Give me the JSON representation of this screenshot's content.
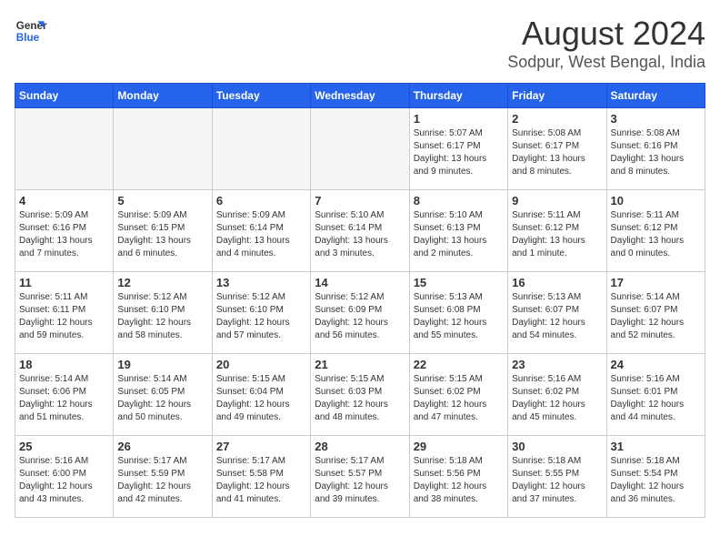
{
  "header": {
    "logo_line1": "General",
    "logo_line2": "Blue",
    "title": "August 2024",
    "subtitle": "Sodpur, West Bengal, India"
  },
  "columns": [
    "Sunday",
    "Monday",
    "Tuesday",
    "Wednesday",
    "Thursday",
    "Friday",
    "Saturday"
  ],
  "weeks": [
    [
      {
        "day": "",
        "empty": true
      },
      {
        "day": "",
        "empty": true
      },
      {
        "day": "",
        "empty": true
      },
      {
        "day": "",
        "empty": true
      },
      {
        "day": "1",
        "info": "Sunrise: 5:07 AM\nSunset: 6:17 PM\nDaylight: 13 hours\nand 9 minutes."
      },
      {
        "day": "2",
        "info": "Sunrise: 5:08 AM\nSunset: 6:17 PM\nDaylight: 13 hours\nand 8 minutes."
      },
      {
        "day": "3",
        "info": "Sunrise: 5:08 AM\nSunset: 6:16 PM\nDaylight: 13 hours\nand 8 minutes."
      }
    ],
    [
      {
        "day": "4",
        "info": "Sunrise: 5:09 AM\nSunset: 6:16 PM\nDaylight: 13 hours\nand 7 minutes."
      },
      {
        "day": "5",
        "info": "Sunrise: 5:09 AM\nSunset: 6:15 PM\nDaylight: 13 hours\nand 6 minutes."
      },
      {
        "day": "6",
        "info": "Sunrise: 5:09 AM\nSunset: 6:14 PM\nDaylight: 13 hours\nand 4 minutes."
      },
      {
        "day": "7",
        "info": "Sunrise: 5:10 AM\nSunset: 6:14 PM\nDaylight: 13 hours\nand 3 minutes."
      },
      {
        "day": "8",
        "info": "Sunrise: 5:10 AM\nSunset: 6:13 PM\nDaylight: 13 hours\nand 2 minutes."
      },
      {
        "day": "9",
        "info": "Sunrise: 5:11 AM\nSunset: 6:12 PM\nDaylight: 13 hours\nand 1 minute."
      },
      {
        "day": "10",
        "info": "Sunrise: 5:11 AM\nSunset: 6:12 PM\nDaylight: 13 hours\nand 0 minutes."
      }
    ],
    [
      {
        "day": "11",
        "info": "Sunrise: 5:11 AM\nSunset: 6:11 PM\nDaylight: 12 hours\nand 59 minutes."
      },
      {
        "day": "12",
        "info": "Sunrise: 5:12 AM\nSunset: 6:10 PM\nDaylight: 12 hours\nand 58 minutes."
      },
      {
        "day": "13",
        "info": "Sunrise: 5:12 AM\nSunset: 6:10 PM\nDaylight: 12 hours\nand 57 minutes."
      },
      {
        "day": "14",
        "info": "Sunrise: 5:12 AM\nSunset: 6:09 PM\nDaylight: 12 hours\nand 56 minutes."
      },
      {
        "day": "15",
        "info": "Sunrise: 5:13 AM\nSunset: 6:08 PM\nDaylight: 12 hours\nand 55 minutes."
      },
      {
        "day": "16",
        "info": "Sunrise: 5:13 AM\nSunset: 6:07 PM\nDaylight: 12 hours\nand 54 minutes."
      },
      {
        "day": "17",
        "info": "Sunrise: 5:14 AM\nSunset: 6:07 PM\nDaylight: 12 hours\nand 52 minutes."
      }
    ],
    [
      {
        "day": "18",
        "info": "Sunrise: 5:14 AM\nSunset: 6:06 PM\nDaylight: 12 hours\nand 51 minutes."
      },
      {
        "day": "19",
        "info": "Sunrise: 5:14 AM\nSunset: 6:05 PM\nDaylight: 12 hours\nand 50 minutes."
      },
      {
        "day": "20",
        "info": "Sunrise: 5:15 AM\nSunset: 6:04 PM\nDaylight: 12 hours\nand 49 minutes."
      },
      {
        "day": "21",
        "info": "Sunrise: 5:15 AM\nSunset: 6:03 PM\nDaylight: 12 hours\nand 48 minutes."
      },
      {
        "day": "22",
        "info": "Sunrise: 5:15 AM\nSunset: 6:02 PM\nDaylight: 12 hours\nand 47 minutes."
      },
      {
        "day": "23",
        "info": "Sunrise: 5:16 AM\nSunset: 6:02 PM\nDaylight: 12 hours\nand 45 minutes."
      },
      {
        "day": "24",
        "info": "Sunrise: 5:16 AM\nSunset: 6:01 PM\nDaylight: 12 hours\nand 44 minutes."
      }
    ],
    [
      {
        "day": "25",
        "info": "Sunrise: 5:16 AM\nSunset: 6:00 PM\nDaylight: 12 hours\nand 43 minutes."
      },
      {
        "day": "26",
        "info": "Sunrise: 5:17 AM\nSunset: 5:59 PM\nDaylight: 12 hours\nand 42 minutes."
      },
      {
        "day": "27",
        "info": "Sunrise: 5:17 AM\nSunset: 5:58 PM\nDaylight: 12 hours\nand 41 minutes."
      },
      {
        "day": "28",
        "info": "Sunrise: 5:17 AM\nSunset: 5:57 PM\nDaylight: 12 hours\nand 39 minutes."
      },
      {
        "day": "29",
        "info": "Sunrise: 5:18 AM\nSunset: 5:56 PM\nDaylight: 12 hours\nand 38 minutes."
      },
      {
        "day": "30",
        "info": "Sunrise: 5:18 AM\nSunset: 5:55 PM\nDaylight: 12 hours\nand 37 minutes."
      },
      {
        "day": "31",
        "info": "Sunrise: 5:18 AM\nSunset: 5:54 PM\nDaylight: 12 hours\nand 36 minutes."
      }
    ]
  ]
}
